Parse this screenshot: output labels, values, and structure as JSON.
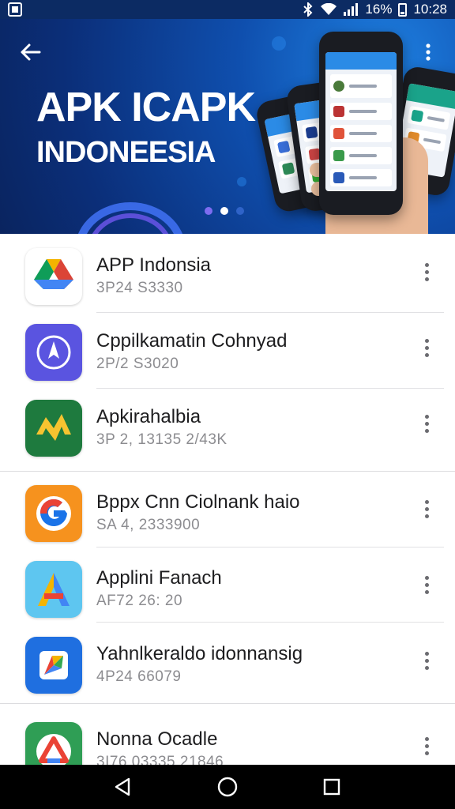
{
  "status_bar": {
    "battery": "16%",
    "time": "10:28"
  },
  "banner": {
    "title": "APK ICAPK",
    "subtitle": "INDONEESIA",
    "active_slide": 2,
    "slide_count": 3
  },
  "apps": [
    {
      "name": "APP Indonsia",
      "meta": "3P24 S3330",
      "icon": "google-drive-icon"
    },
    {
      "name": "Cppilkamatin Cohnyad",
      "meta": "2P/2 S3020",
      "icon": "compass-plane-icon"
    },
    {
      "name": "Apkirahalbia",
      "meta": "3P 2, 13135 2/43K",
      "icon": "yellow-arrows-icon"
    },
    {
      "name": "Bppx Cnn Ciolnank haio",
      "meta": "SA 4, 2333900",
      "icon": "g-logo-icon"
    },
    {
      "name": "Applini Fanach",
      "meta": "AF72 26: 20",
      "icon": "letter-a-icon"
    },
    {
      "name": "Yahnlkeraldo idonnansig",
      "meta": "4P24 66079",
      "icon": "pinwheel-icon"
    },
    {
      "name": "Nonna Ocadle",
      "meta": "3I76 03335 21846",
      "icon": "triangle-logo-icon"
    }
  ],
  "nav": {
    "back": "back-triangle-icon",
    "home": "home-circle-icon",
    "recents": "recents-square-icon"
  }
}
